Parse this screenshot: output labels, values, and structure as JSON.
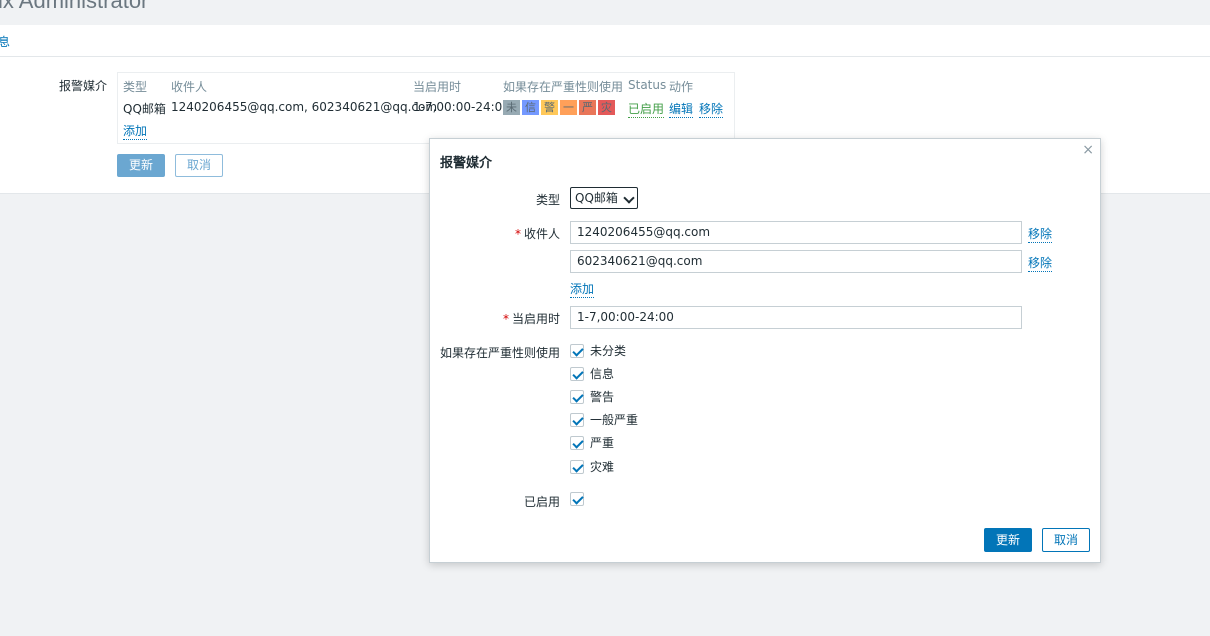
{
  "header": {
    "title": "ix Administrator"
  },
  "tabs": {
    "partial_tab": "息"
  },
  "form": {
    "media_label": "报警媒介",
    "table": {
      "headers": {
        "type": "类型",
        "recipient": "收件人",
        "when_active": "当启用时",
        "use_if_severity": "如果存在严重性则使用",
        "status": "Status",
        "action": "动作"
      },
      "row": {
        "type": "QQ邮箱",
        "recipients": "1240206455@qq.com, 602340621@qq.com",
        "when_active": "1-7,00:00-24:00",
        "severities": [
          {
            "abbr": "未",
            "color": "#97aab3"
          },
          {
            "abbr": "信",
            "color": "#7499ff"
          },
          {
            "abbr": "警",
            "color": "#ffc859"
          },
          {
            "abbr": "一",
            "color": "#ffa059"
          },
          {
            "abbr": "严",
            "color": "#e97659"
          },
          {
            "abbr": "灾",
            "color": "#e45959"
          }
        ],
        "status": "已启用",
        "edit": "编辑",
        "remove": "移除"
      },
      "add": "添加"
    },
    "update_button": "更新",
    "cancel_button": "取消"
  },
  "dialog": {
    "title": "报警媒介",
    "close": "×",
    "type_label": "类型",
    "type_value": "QQ邮箱",
    "recipient_label": "收件人",
    "recipients": [
      "1240206455@qq.com",
      "602340621@qq.com"
    ],
    "remove": "移除",
    "add": "添加",
    "when_active_label": "当启用时",
    "when_active_value": "1-7,00:00-24:00",
    "severity_label": "如果存在严重性则使用",
    "severities": [
      "未分类",
      "信息",
      "警告",
      "一般严重",
      "严重",
      "灾难"
    ],
    "enabled_label": "已启用",
    "update_button": "更新",
    "cancel_button": "取消"
  }
}
